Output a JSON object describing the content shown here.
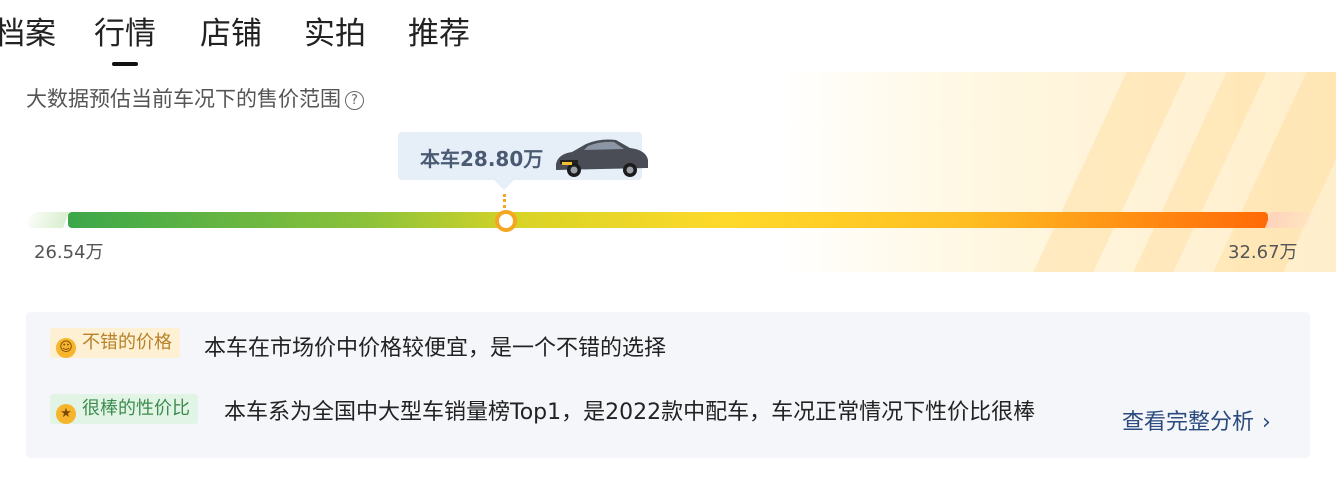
{
  "tabs": [
    {
      "label": "档案"
    },
    {
      "label": "行情",
      "active": true
    },
    {
      "label": "店铺"
    },
    {
      "label": "实拍"
    },
    {
      "label": "推荐"
    }
  ],
  "subtitle": "大数据预估当前车况下的售价范围",
  "price_bubble": {
    "label": "本车28.80万"
  },
  "range": {
    "min_label": "26.54万",
    "max_label": "32.67万",
    "current_value": 28.8,
    "min": 26.54,
    "max": 32.67
  },
  "info": {
    "tag1": "不错的价格",
    "desc1": "本车在市场价中价格较便宜，是一个不错的选择",
    "tag2": "很棒的性价比",
    "desc2": "本车系为全国中大型车销量榜Top1，是2022款中配车，车况正常情况下性价比很棒",
    "link": "查看完整分析"
  },
  "icons": {
    "help": "question-circle-icon",
    "chevron": "chevron-right-icon",
    "smile": "smile-emoji-icon",
    "star_eyes": "star-eyes-emoji-icon"
  },
  "colors": {
    "accent": "#f5a623",
    "link": "#2b4a7d",
    "green": "#3ba74a",
    "orange": "#ff6a08"
  }
}
